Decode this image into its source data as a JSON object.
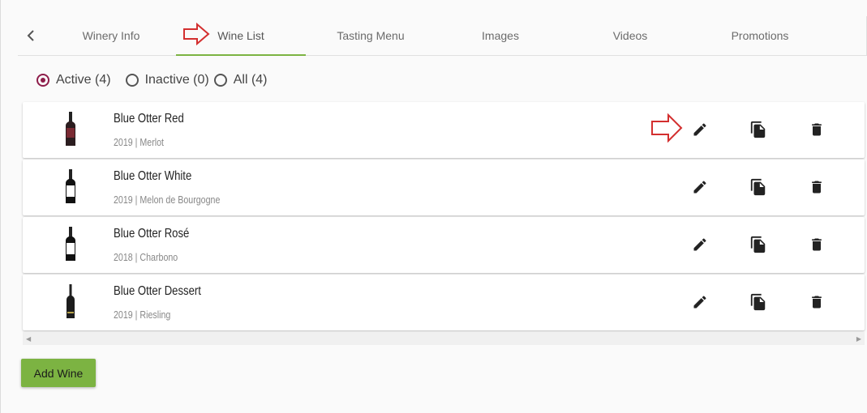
{
  "tabs": [
    {
      "label": "Winery Info",
      "active": false
    },
    {
      "label": "Wine List",
      "active": true
    },
    {
      "label": "Tasting Menu",
      "active": false
    },
    {
      "label": "Images",
      "active": false
    },
    {
      "label": "Videos",
      "active": false
    },
    {
      "label": "Promotions",
      "active": false
    }
  ],
  "filters": [
    {
      "label": "Active (4)",
      "checked": true
    },
    {
      "label": "Inactive (0)",
      "checked": false
    },
    {
      "label": "All (4)",
      "checked": false
    }
  ],
  "wines": [
    {
      "name": "Blue Otter Red",
      "meta": "2019 | Merlot",
      "bottle": "red-wine-bottle-icon"
    },
    {
      "name": "Blue Otter White",
      "meta": "2019 | Melon de Bourgogne",
      "bottle": "white-wine-bottle-icon"
    },
    {
      "name": "Blue Otter Rosé",
      "meta": "2018 | Charbono",
      "bottle": "rose-wine-bottle-icon"
    },
    {
      "name": "Blue Otter Dessert",
      "meta": "2019 | Riesling",
      "bottle": "dessert-wine-bottle-icon"
    }
  ],
  "add_button_label": "Add Wine",
  "colors": {
    "accent": "#7cb342",
    "radio": "#8e1d4a",
    "callout": "#d32f2f"
  }
}
